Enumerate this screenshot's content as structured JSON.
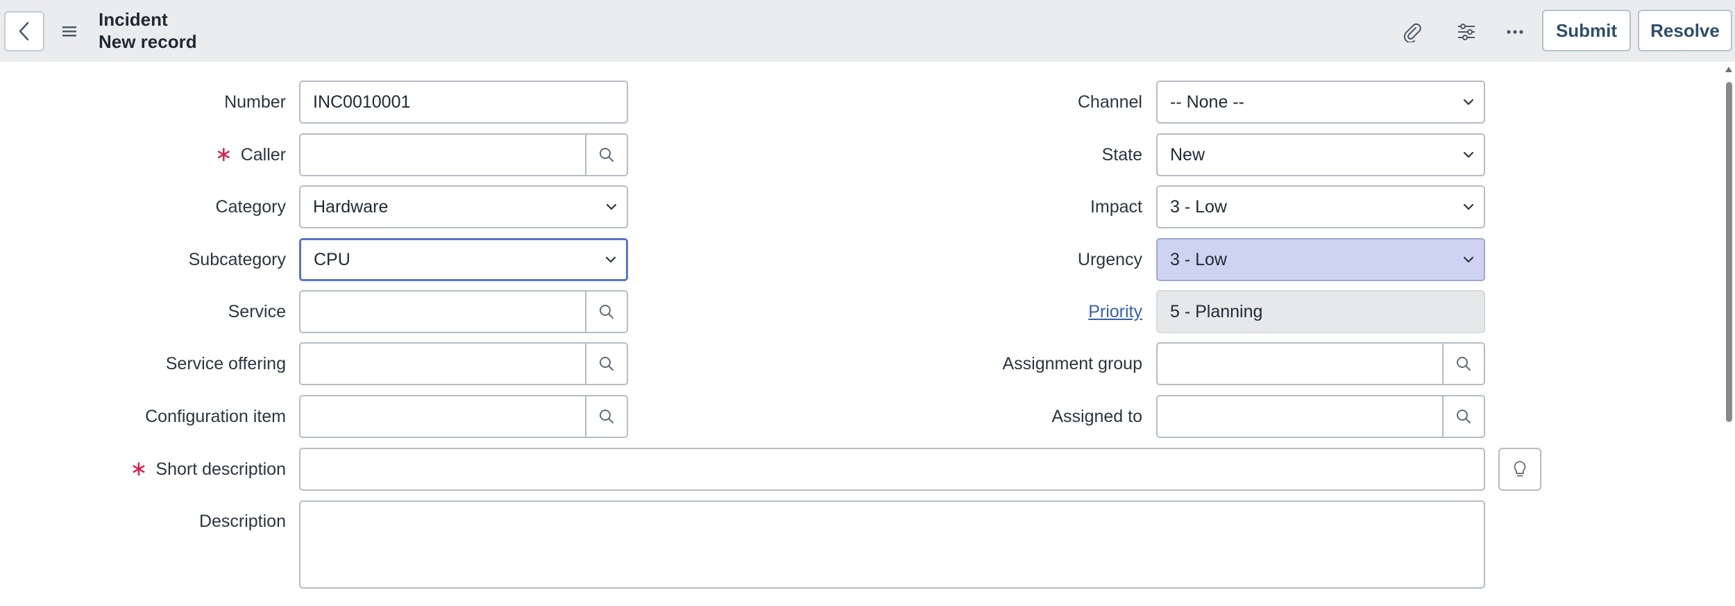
{
  "header": {
    "title": "Incident",
    "subtitle": "New record",
    "submit_label": "Submit",
    "resolve_label": "Resolve"
  },
  "form": {
    "number": {
      "label": "Number",
      "value": "INC0010001"
    },
    "caller": {
      "label": "Caller",
      "value": "",
      "required": true
    },
    "category": {
      "label": "Category",
      "value": "Hardware"
    },
    "subcategory": {
      "label": "Subcategory",
      "value": "CPU"
    },
    "service": {
      "label": "Service",
      "value": ""
    },
    "service_offering": {
      "label": "Service offering",
      "value": ""
    },
    "configuration_item": {
      "label": "Configuration item",
      "value": ""
    },
    "short_description": {
      "label": "Short description",
      "value": "",
      "required": true
    },
    "description": {
      "label": "Description",
      "value": ""
    },
    "channel": {
      "label": "Channel",
      "value": "-- None --"
    },
    "state": {
      "label": "State",
      "value": "New"
    },
    "impact": {
      "label": "Impact",
      "value": "3 - Low"
    },
    "urgency": {
      "label": "Urgency",
      "value": "3 - Low"
    },
    "priority": {
      "label": "Priority",
      "value": "5 - Planning"
    },
    "assignment_group": {
      "label": "Assignment group",
      "value": ""
    },
    "assigned_to": {
      "label": "Assigned to",
      "value": ""
    }
  },
  "colors": {
    "header_bg": "#eaecee",
    "required_mark": "#d4224e",
    "link": "#3a5fad",
    "focus_border": "#5a74c9",
    "highlight_bg": "#cdd3f0"
  },
  "icons": {
    "back": "chevron-left-icon",
    "menu": "hamburger-icon",
    "attachment": "paperclip-icon",
    "personalize": "sliders-icon",
    "more": "ellipsis-icon",
    "lookup": "search-icon",
    "dropdown": "chevron-down-icon",
    "suggestion": "lightbulb-icon"
  }
}
